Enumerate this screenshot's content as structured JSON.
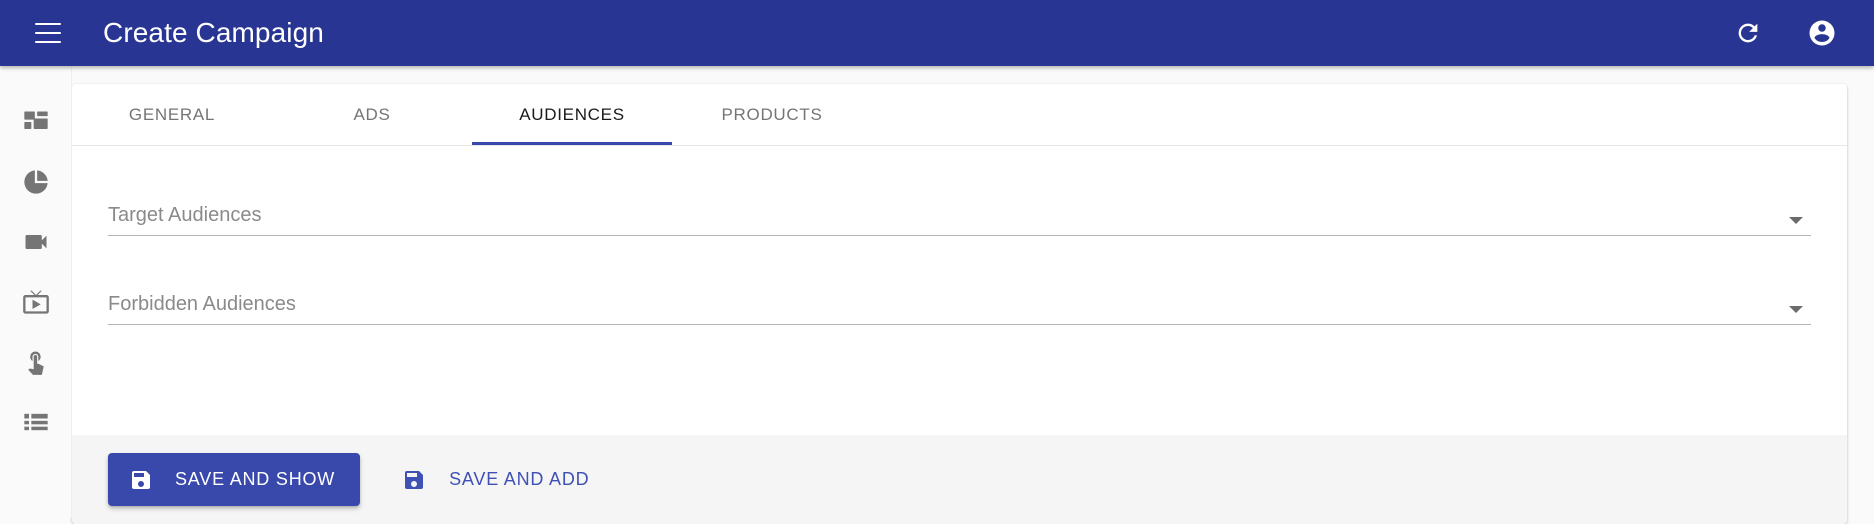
{
  "appbar": {
    "title": "Create Campaign",
    "menu_icon": "hamburger-menu-icon",
    "refresh_icon": "refresh-icon",
    "account_icon": "account-circle-icon",
    "background_color": "#283593"
  },
  "sidebar": {
    "items": [
      {
        "icon": "dashboard-icon",
        "name": "sidebar-item-dashboard"
      },
      {
        "icon": "pie-chart-icon",
        "name": "sidebar-item-reports"
      },
      {
        "icon": "videocam-icon",
        "name": "sidebar-item-videos"
      },
      {
        "icon": "live-tv-icon",
        "name": "sidebar-item-live-tv"
      },
      {
        "icon": "touch-app-icon",
        "name": "sidebar-item-interactions"
      },
      {
        "icon": "list-icon",
        "name": "sidebar-item-list"
      }
    ]
  },
  "tabs": [
    {
      "label": "General",
      "active": false
    },
    {
      "label": "Ads",
      "active": false
    },
    {
      "label": "Audiences",
      "active": true
    },
    {
      "label": "Products",
      "active": false
    }
  ],
  "form": {
    "fields": [
      {
        "label": "Target Audiences",
        "value": "",
        "placeholder": "Target Audiences",
        "control": "select",
        "arrow_icon": "dropdown-arrow-icon"
      },
      {
        "label": "Forbidden Audiences",
        "value": "",
        "placeholder": "Forbidden Audiences",
        "control": "select",
        "arrow_icon": "dropdown-arrow-icon"
      }
    ]
  },
  "actions": {
    "primary": {
      "label": "Save and show",
      "icon": "save-icon",
      "color": "#3949ab"
    },
    "secondary": {
      "label": "Save and add",
      "icon": "save-icon",
      "color": "#3f51b5"
    }
  }
}
